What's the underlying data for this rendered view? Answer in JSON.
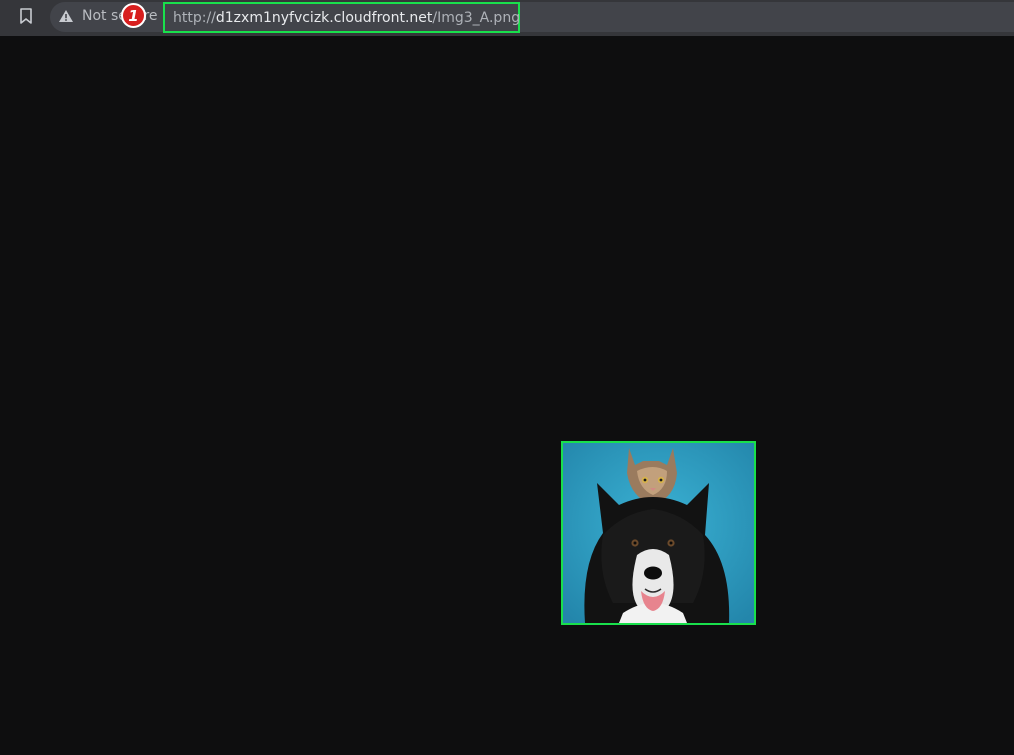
{
  "toolbar": {
    "bookmark_icon": "bookmark-icon",
    "security_icon": "warning-triangle-icon",
    "security_label": "Not secure",
    "url_scheme": "http://",
    "url_host": "d1zxm1nyfvcizk.cloudfront.net",
    "url_path": "/Img3_A.png"
  },
  "annotation": {
    "marker_label": "1",
    "marker_color": "#d71f1f",
    "highlight_color": "#19e04c"
  },
  "image": {
    "subject": "dog-and-cat-photo",
    "background_color": "#2f9dc0"
  }
}
